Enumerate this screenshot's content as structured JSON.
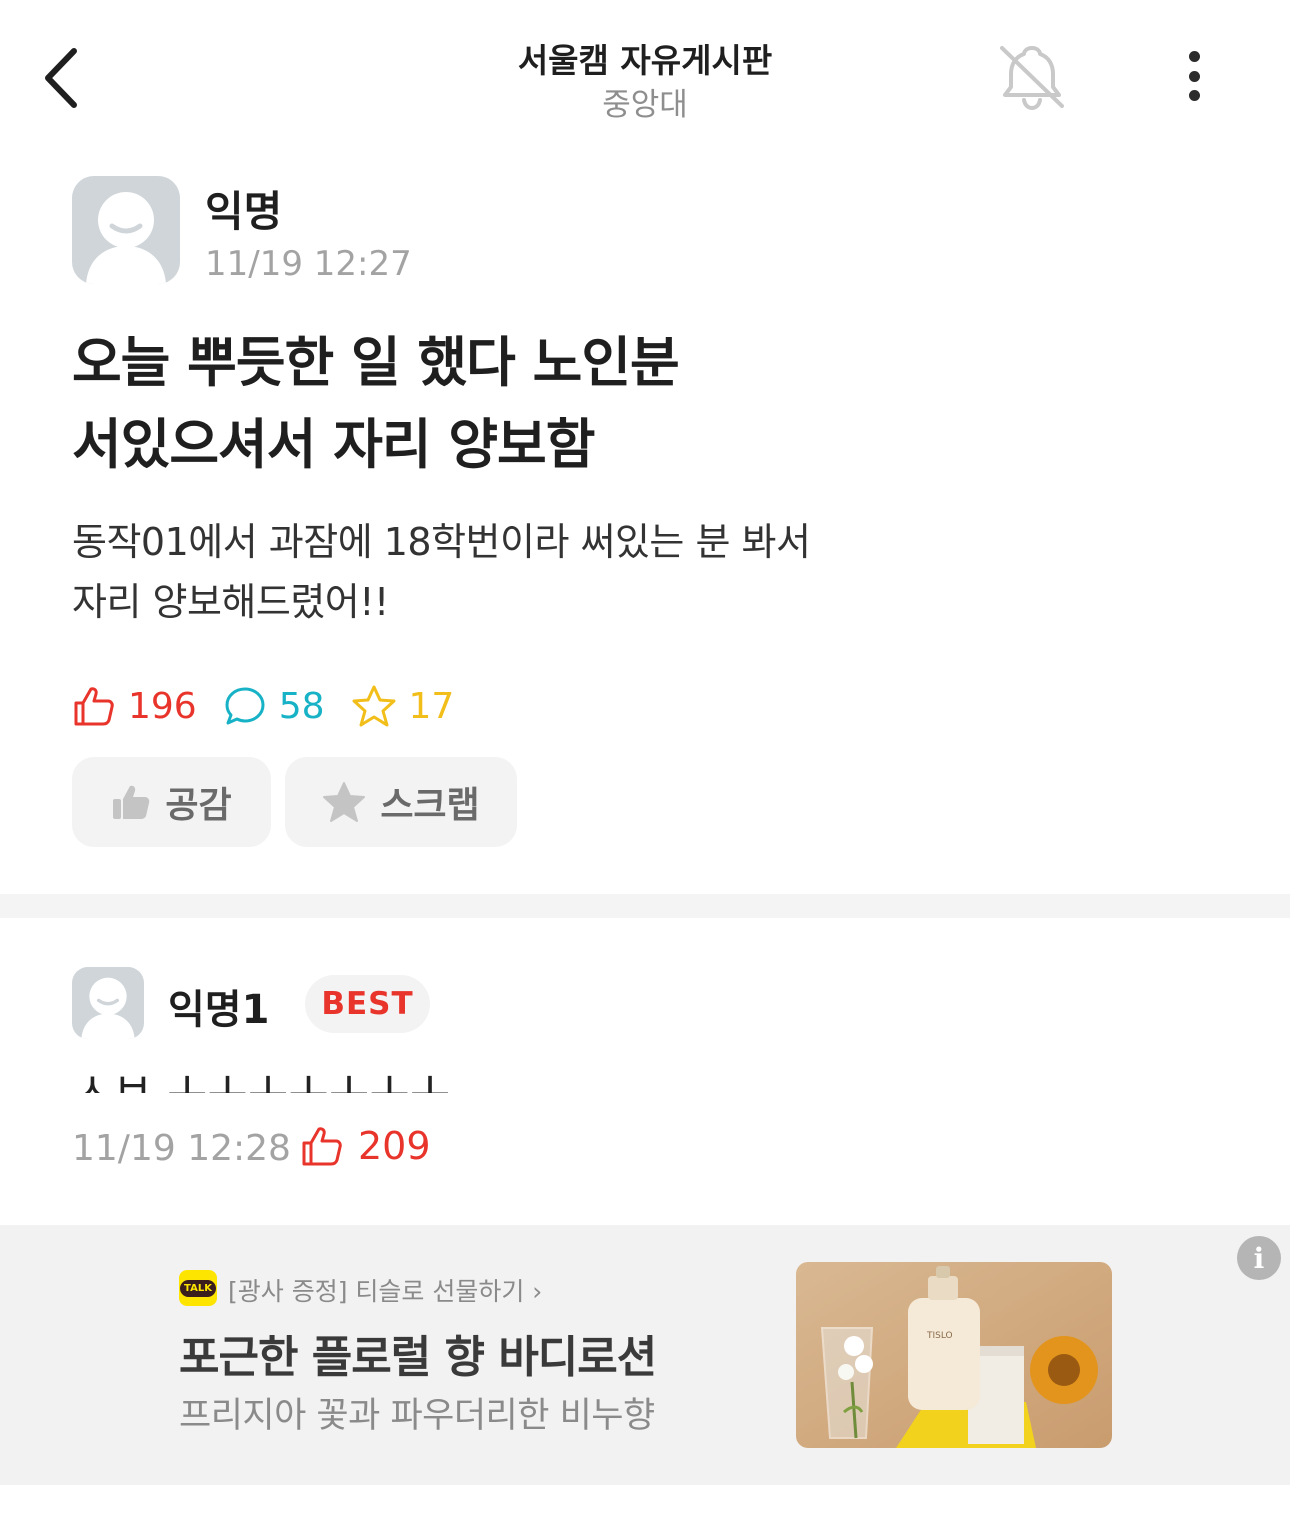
{
  "header": {
    "title": "서울캠 자유게시판",
    "subtitle": "중앙대",
    "back_icon": "chevron-left-icon",
    "notification_icon": "bell-off-icon",
    "more_icon": "more-vertical-icon"
  },
  "post": {
    "author": "익명",
    "time": "11/19 12:27",
    "title_line1": "오늘 뿌듯한 일 했다 노인분",
    "title_line2": "서있으셔서 자리 양보함",
    "body_line1": "동작01에서 과잠에 18학번이라 써있는 분 봐서",
    "body_line2": "자리 양보해드렸어!!",
    "stats": {
      "likes": "196",
      "comments": "58",
      "scraps": "17"
    },
    "actions": {
      "like_label": "공감",
      "scrap_label": "스크랩"
    }
  },
  "comment": {
    "author": "익명1",
    "badge": "BEST",
    "text": "ㅅㅂ ㅗㅗㅗㅗㅗㅗㅗ",
    "time": "11/19 12:28",
    "likes": "209"
  },
  "ad": {
    "channel_icon": "kakaotalk-icon",
    "talk_badge": "TALK",
    "sponsor": "[광사 증정] 티슬로 선물하기 ›",
    "title": "포근한 플로럴 향 바디로션",
    "description": "프리지아 꽃과 파우더리한 비누향",
    "product_label": "TISLO",
    "info_icon": "info-icon"
  },
  "colors": {
    "like": "#e8342b",
    "comment": "#17b2c6",
    "scrap": "#f2be1a",
    "muted": "#a3a3a3",
    "avatar": "#cfd5d8"
  }
}
